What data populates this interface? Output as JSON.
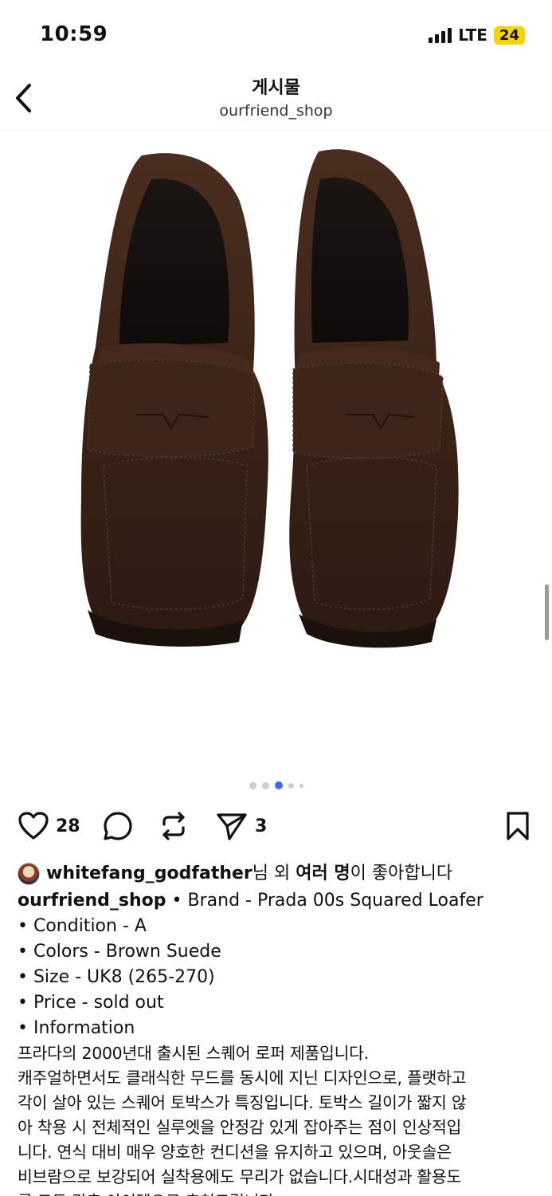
{
  "status": {
    "time": "10:59",
    "network": "LTE",
    "battery": "24"
  },
  "nav": {
    "title": "게시물",
    "subtitle": "ourfriend_shop"
  },
  "carousel": {
    "count": 5,
    "active_index": 2
  },
  "actions": {
    "likes": "28",
    "shares": "3"
  },
  "liked_by": {
    "user": "whitefang_godfather",
    "suffix_plain_1": "님 외 ",
    "suffix_bold": "여러 명",
    "suffix_plain_2": "이 좋아합니다"
  },
  "post": {
    "author": "ourfriend_shop",
    "lines": [
      " • Brand - Prada 00s Squared Loafer",
      "• Condition -  A",
      "• Colors - Brown Suede",
      "• Size - UK8 (265-270)",
      "• Price -  sold out",
      "• Information"
    ],
    "korean_lines": [
      "프라다의 2000년대 출시된 스퀘어 로퍼 제품입니다.",
      "캐주얼하면서도 클래식한 무드를 동시에 지닌 디자인으로, 플랫하고",
      "각이 살아 있는 스퀘어 토박스가 특징입니다. 토박스 길이가 짧지 않",
      "아 착용 시 전체적인 실루엣을 안정감 있게 잡아주는 점이 인상적입",
      "니다. 연식 대비 매우 양호한 컨디션을 유지하고 있으며, 아웃솔은",
      "비브람으로 보강되어 실착용에도 무리가 없습니다.시대성과 활용도",
      "를 모두 갖춘 아이템으로 추천드립니다."
    ]
  },
  "colors": {
    "shoe": "#3b2418",
    "accent_dot": "#3b6cf5"
  }
}
